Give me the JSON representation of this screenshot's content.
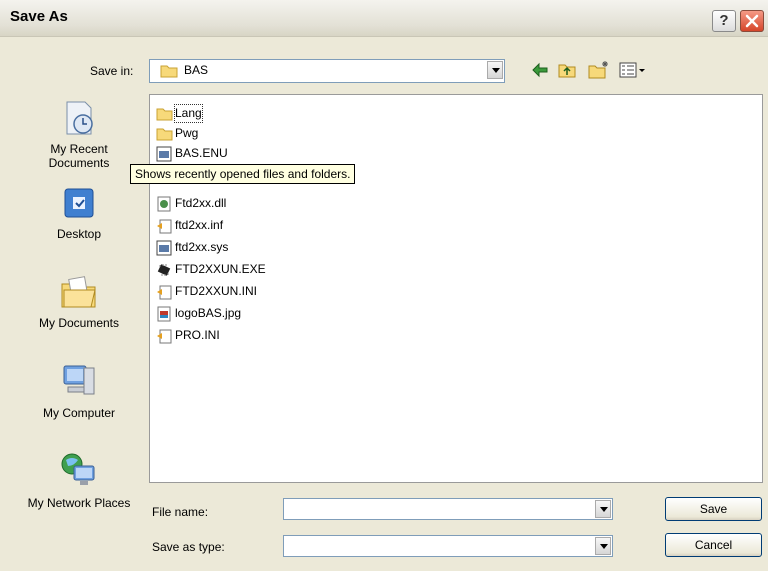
{
  "window": {
    "title": "Save As",
    "help_label": "?"
  },
  "toolbar": {
    "save_in_label": "Save in:",
    "save_in_value": "BAS",
    "icons": [
      "back-arrow-icon",
      "up-one-level-icon",
      "new-folder-icon",
      "view-menu-icon"
    ]
  },
  "places": [
    {
      "label": "My Recent Documents",
      "icon": "recent-documents-icon"
    },
    {
      "label": "Desktop",
      "icon": "desktop-icon"
    },
    {
      "label": "My Documents",
      "icon": "my-documents-icon"
    },
    {
      "label": "My Computer",
      "icon": "my-computer-icon"
    },
    {
      "label": "My Network Places",
      "icon": "network-places-icon"
    }
  ],
  "files": [
    {
      "name": "Lang",
      "icon": "folder-icon"
    },
    {
      "name": "Pwg",
      "icon": "folder-icon"
    },
    {
      "name": "BAS.ENU",
      "icon": "system-file-icon"
    },
    {
      "name": "",
      "icon": "file-icon"
    },
    {
      "name": "Ftd2xx.dll",
      "icon": "dll-file-icon"
    },
    {
      "name": "ftd2xx.inf",
      "icon": "settings-file-icon"
    },
    {
      "name": "ftd2xx.sys",
      "icon": "system-file-icon"
    },
    {
      "name": "FTD2XXUN.EXE",
      "icon": "chip-executable-icon"
    },
    {
      "name": "FTD2XXUN.INI",
      "icon": "settings-file-icon"
    },
    {
      "name": "logoBAS.jpg",
      "icon": "image-file-icon"
    },
    {
      "name": "PRO.INI",
      "icon": "settings-file-icon"
    }
  ],
  "tooltip": "Shows recently opened files and folders.",
  "form": {
    "file_name_label": "File name:",
    "file_name_value": "",
    "save_type_label": "Save as type:",
    "save_type_value": ""
  },
  "buttons": {
    "save": "Save",
    "cancel": "Cancel"
  }
}
